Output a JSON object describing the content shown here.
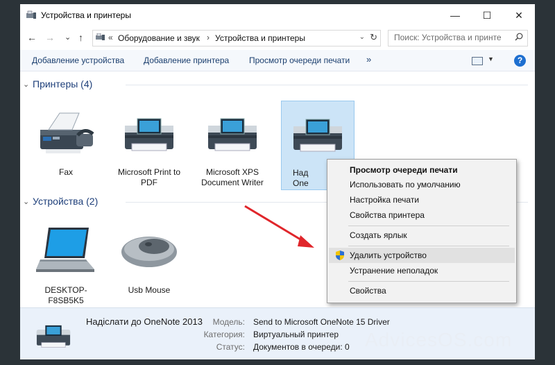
{
  "window": {
    "title": "Устройства и принтеры",
    "controls": {
      "minimize": "—",
      "maximize": "☐",
      "close": "✕"
    }
  },
  "navigation": {
    "back": "←",
    "forward": "→",
    "recent": "⌄",
    "up": "↑",
    "breadcrumb_sep": "«",
    "breadcrumb": [
      "Оборудование и звук",
      "Устройства и принтеры"
    ],
    "breadcrumb_arrow": "›",
    "dropdown": "⌄",
    "refresh": "↻",
    "search_placeholder": "Поиск: Устройства и принте"
  },
  "toolbar": {
    "commands": [
      "Добавление устройства",
      "Добавление принтера",
      "Просмотр очереди печати"
    ],
    "more": "»",
    "view_dropdown": "▼",
    "help": "?"
  },
  "groups": {
    "printers": {
      "chevron": "⌄",
      "title": "Принтеры (4)"
    },
    "devices": {
      "chevron": "⌄",
      "title": "Устройства (2)"
    }
  },
  "printers": [
    {
      "label": "Fax"
    },
    {
      "label": "Microsoft Print to PDF"
    },
    {
      "label": "Microsoft XPS Document Writer"
    },
    {
      "label": "Над\nOne"
    }
  ],
  "devices": [
    {
      "label": "DESKTOP-F8SB5K5"
    },
    {
      "label": "Usb Mouse"
    }
  ],
  "context_menu": {
    "items": [
      {
        "label": "Просмотр очереди печати",
        "bold": true
      },
      {
        "label": "Использовать по умолчанию"
      },
      {
        "label": "Настройка печати"
      },
      {
        "label": "Свойства принтера"
      },
      {
        "label": "Создать ярлык"
      },
      {
        "label": "Удалить устройство",
        "icon": "uac-shield-icon",
        "highlighted": true
      },
      {
        "label": "Устранение неполадок"
      },
      {
        "label": "Свойства"
      }
    ]
  },
  "details": {
    "name": "Надіслати до OneNote 2013",
    "fields": [
      {
        "key": "Модель:",
        "value": "Send to Microsoft OneNote 15 Driver"
      },
      {
        "key": "Категория:",
        "value": "Виртуальный принтер"
      },
      {
        "key": "Статус:",
        "value": "Документов в очереди: 0"
      }
    ]
  },
  "watermark": "AdvicesOS.com",
  "colors": {
    "accent": "#1e6fd0",
    "selection": "#cce4f7",
    "group_header": "#1e3f7a",
    "arrow": "#e0262b"
  }
}
